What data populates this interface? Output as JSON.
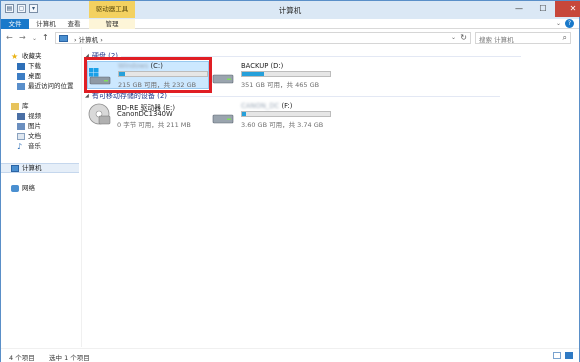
{
  "window": {
    "title": "计算机",
    "contextual_tab_group": "驱动器工具",
    "controls": {
      "minimize": "—",
      "maximize": "☐",
      "close": "✕"
    }
  },
  "ribbon": {
    "tabs": [
      {
        "label": "文件"
      },
      {
        "label": "计算机"
      },
      {
        "label": "查看"
      },
      {
        "label": "管理"
      }
    ],
    "expand_glyph": "⌄",
    "help_glyph": "?"
  },
  "nav_buttons": {
    "back": "←",
    "forward": "→",
    "recent": "⌄",
    "up": "↑"
  },
  "address": {
    "path": "›  计算机  ›",
    "dropdown": "⌄",
    "refresh": "↻"
  },
  "search": {
    "placeholder": "搜索 计算机",
    "icon": "search-icon",
    "glyph": "⌕"
  },
  "nav_pane": {
    "favorites": {
      "label": "收藏夹",
      "items": [
        "下载",
        "桌面",
        "最近访问的位置"
      ]
    },
    "libraries": {
      "label": "库",
      "items": [
        "视频",
        "图片",
        "文档",
        "音乐"
      ]
    },
    "computer": "计算机",
    "network": "网络"
  },
  "groups": {
    "hard_drives": {
      "label": "硬盘 (2)",
      "chevron": "◢"
    },
    "removable": {
      "label": "有可移动存储的设备 (2)",
      "chevron": "◢"
    }
  },
  "drives": {
    "c": {
      "name_blurred": "Windows",
      "letter": "(C:)",
      "info": "215 GB 可用，共 232 GB",
      "used_fraction": 0.07
    },
    "d": {
      "name": "BACKUP (D:)",
      "info": "351 GB 可用，共 465 GB",
      "used_fraction": 0.25
    },
    "e": {
      "name_line1": "BD-RE 驱动器 (E:)",
      "name_line2": "CanonDC1340W",
      "info": "0 字节 可用，共 211 MB"
    },
    "f": {
      "name_blurred": "CANON_DC",
      "letter": "(F:)",
      "info": "3.60 GB 可用，共 3.74 GB",
      "used_fraction": 0.04
    }
  },
  "status": {
    "items": "4 个项目",
    "selected": "选中 1 个项目"
  },
  "colors": {
    "accent": "#1979ca",
    "highlight": "#e01e24",
    "selection": "#cce8ff",
    "capacity": "#26a0da"
  }
}
